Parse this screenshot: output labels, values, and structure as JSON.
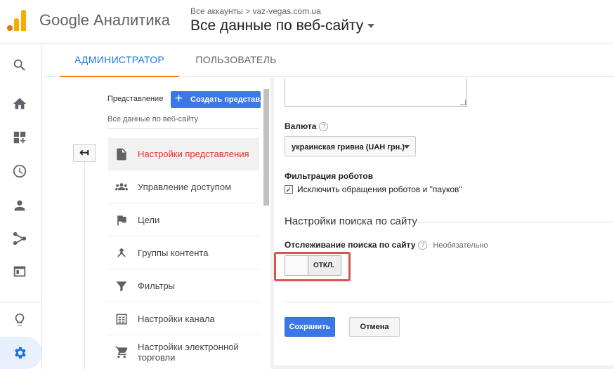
{
  "header": {
    "brand": "Google Аналитика",
    "breadcrumb_root": "Все аккаунты",
    "breadcrumb_sep": ">",
    "breadcrumb_account": "vaz-vegas.com.ua",
    "view_selector": "Все данные по веб-сайту"
  },
  "colors": {
    "accent": "#1a73e8",
    "active_nav": "#d93025",
    "primary_button": "#3b78e7",
    "highlight": "#d9534f",
    "logo_orange": "#f9ab00",
    "logo_dark": "#e37400"
  },
  "rail": {
    "icons": [
      "search-icon",
      "home-icon",
      "customization-icon",
      "realtime-icon",
      "audience-icon",
      "acquisition-icon",
      "behavior-icon",
      "discover-icon",
      "admin-gear-icon"
    ]
  },
  "tabs": [
    {
      "label": "АДМИНИСТРАТОР",
      "active": true
    },
    {
      "label": "ПОЛЬЗОВАТЕЛЬ",
      "active": false
    }
  ],
  "column": {
    "label": "Представление",
    "create_button": "Создать представление",
    "view_name": "Все данные по веб-сайту",
    "items": [
      {
        "label": "Настройки представления",
        "icon": "document-icon",
        "active": true
      },
      {
        "label": "Управление доступом",
        "icon": "users-icon",
        "active": false
      },
      {
        "label": "Цели",
        "icon": "flag-icon",
        "active": false
      },
      {
        "label": "Группы контента",
        "icon": "content-group-icon",
        "active": false
      },
      {
        "label": "Фильтры",
        "icon": "filter-icon",
        "active": false
      },
      {
        "label": "Настройки канала",
        "icon": "channel-icon",
        "active": false
      },
      {
        "label": "Настройки электронной торговли",
        "icon": "cart-icon",
        "active": false
      }
    ]
  },
  "panel": {
    "currency_label": "Валюта",
    "currency_value": "украинская гривна (UAH грн.)",
    "bot_filter_label": "Фильтрация роботов",
    "bot_filter_checkbox": "Исключить обращения роботов и \"пауков\"",
    "bot_filter_checked": true,
    "site_search_title": "Настройки поиска по сайту",
    "site_search_tracking_label": "Отслеживание поиска по сайту",
    "site_search_optional": "Необязательно",
    "toggle_state": "ОТКЛ.",
    "save_button": "Сохранить",
    "cancel_button": "Отмена"
  }
}
